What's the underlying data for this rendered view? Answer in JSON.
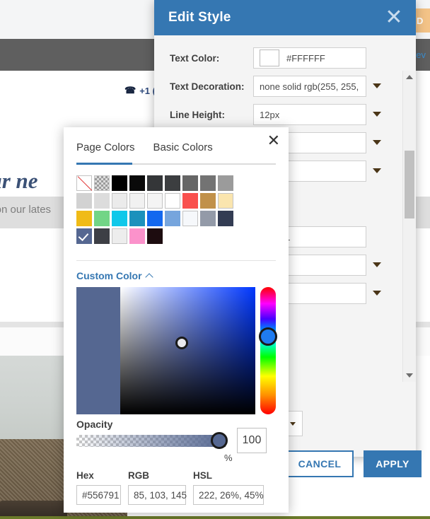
{
  "background": {
    "phone": "+1 (",
    "phone_icon": "phone-icon",
    "heading": "our ne",
    "subtext": "s on our lates",
    "saved_badge": "VED",
    "review_tab": "rev"
  },
  "dialog": {
    "title": "Edit Style",
    "close_icon": "close-icon",
    "fields": [
      {
        "label": "Text Color:",
        "value": "#FFFFFF",
        "swatch": "#FFFFFF",
        "has_swatch": true,
        "has_caret": false
      },
      {
        "label": "Text Decoration:",
        "value": "none solid rgb(255, 255,",
        "has_swatch": false,
        "has_caret": true
      },
      {
        "label": "Line Height:",
        "value": "12px",
        "has_swatch": false,
        "has_caret": true
      },
      {
        "label": "",
        "value": "",
        "has_swatch": false,
        "has_caret": true
      },
      {
        "label": "",
        "value": ")",
        "has_swatch": false,
        "has_caret": true
      },
      {
        "label": "",
        "value": "556791",
        "has_swatch": false,
        "has_caret": false
      },
      {
        "label": "",
        "value": "",
        "has_swatch": false,
        "has_caret": true
      },
      {
        "label": "",
        "value": "",
        "has_swatch": false,
        "has_caret": true
      }
    ],
    "cancel_label": "CANCEL",
    "apply_label": "APPLY",
    "scrollbar": {
      "up_icon": "scroll-up-arrow-icon",
      "down_icon": "scroll-down-arrow-icon"
    }
  },
  "color_picker": {
    "close_icon": "close-icon",
    "tabs": [
      {
        "label": "Page Colors",
        "active": true
      },
      {
        "label": "Basic Colors",
        "active": false
      }
    ],
    "swatches": [
      {
        "color": "none",
        "type": "none",
        "selected": false
      },
      {
        "color": "transparent",
        "type": "transparent",
        "selected": false
      },
      {
        "color": "#000000",
        "type": "solid",
        "selected": false
      },
      {
        "color": "#0a0a0a",
        "type": "solid",
        "selected": false
      },
      {
        "color": "#343638",
        "type": "solid",
        "selected": false
      },
      {
        "color": "#3c3e40",
        "type": "solid",
        "selected": false
      },
      {
        "color": "#666666",
        "type": "solid",
        "selected": false
      },
      {
        "color": "#737373",
        "type": "solid",
        "selected": false
      },
      {
        "color": "#9b9b9b",
        "type": "solid",
        "selected": false
      },
      {
        "color": "#d2d2d2",
        "type": "solid",
        "selected": false
      },
      {
        "color": "#dcdcdc",
        "type": "solid",
        "selected": false
      },
      {
        "color": "#ebebeb",
        "type": "bordered",
        "selected": false
      },
      {
        "color": "#f1f1f1",
        "type": "bordered",
        "selected": false
      },
      {
        "color": "#f4f4f4",
        "type": "bordered",
        "selected": false
      },
      {
        "color": "#ffffff",
        "type": "bordered",
        "selected": false
      },
      {
        "color": "#f9504e",
        "type": "solid",
        "selected": false
      },
      {
        "color": "#c1914a",
        "type": "solid",
        "selected": false
      },
      {
        "color": "#fae5ae",
        "type": "bordered",
        "selected": false
      },
      {
        "color": "#f0bb17",
        "type": "solid",
        "selected": false
      },
      {
        "color": "#72d586",
        "type": "solid",
        "selected": false
      },
      {
        "color": "#10c8ea",
        "type": "solid",
        "selected": false
      },
      {
        "color": "#1c91bc",
        "type": "solid",
        "selected": false
      },
      {
        "color": "#1368ef",
        "type": "solid",
        "selected": false
      },
      {
        "color": "#76a5dd",
        "type": "solid",
        "selected": false
      },
      {
        "color": "#f6f8fb",
        "type": "bordered",
        "selected": false
      },
      {
        "color": "#939aa8",
        "type": "solid",
        "selected": false
      },
      {
        "color": "#333c53",
        "type": "solid",
        "selected": false
      },
      {
        "color": "#556791",
        "type": "solid",
        "selected": true
      },
      {
        "color": "#3d3f45",
        "type": "solid",
        "selected": false
      },
      {
        "color": "#ededed",
        "type": "bordered",
        "selected": false
      },
      {
        "color": "#fb92cb",
        "type": "solid",
        "selected": false
      },
      {
        "color": "#1d0c0f",
        "type": "solid",
        "selected": false
      }
    ],
    "custom_color_label": "Custom Color",
    "custom_color_chevron": "chevron-up-icon",
    "preview_color": "#556791",
    "opacity_label": "Opacity",
    "opacity_value": "100",
    "opacity_unit": "%",
    "values": [
      {
        "label": "Hex",
        "value": "#556791"
      },
      {
        "label": "RGB",
        "value": "85, 103, 145"
      },
      {
        "label": "HSL",
        "value": "222, 26%, 45%"
      }
    ]
  }
}
